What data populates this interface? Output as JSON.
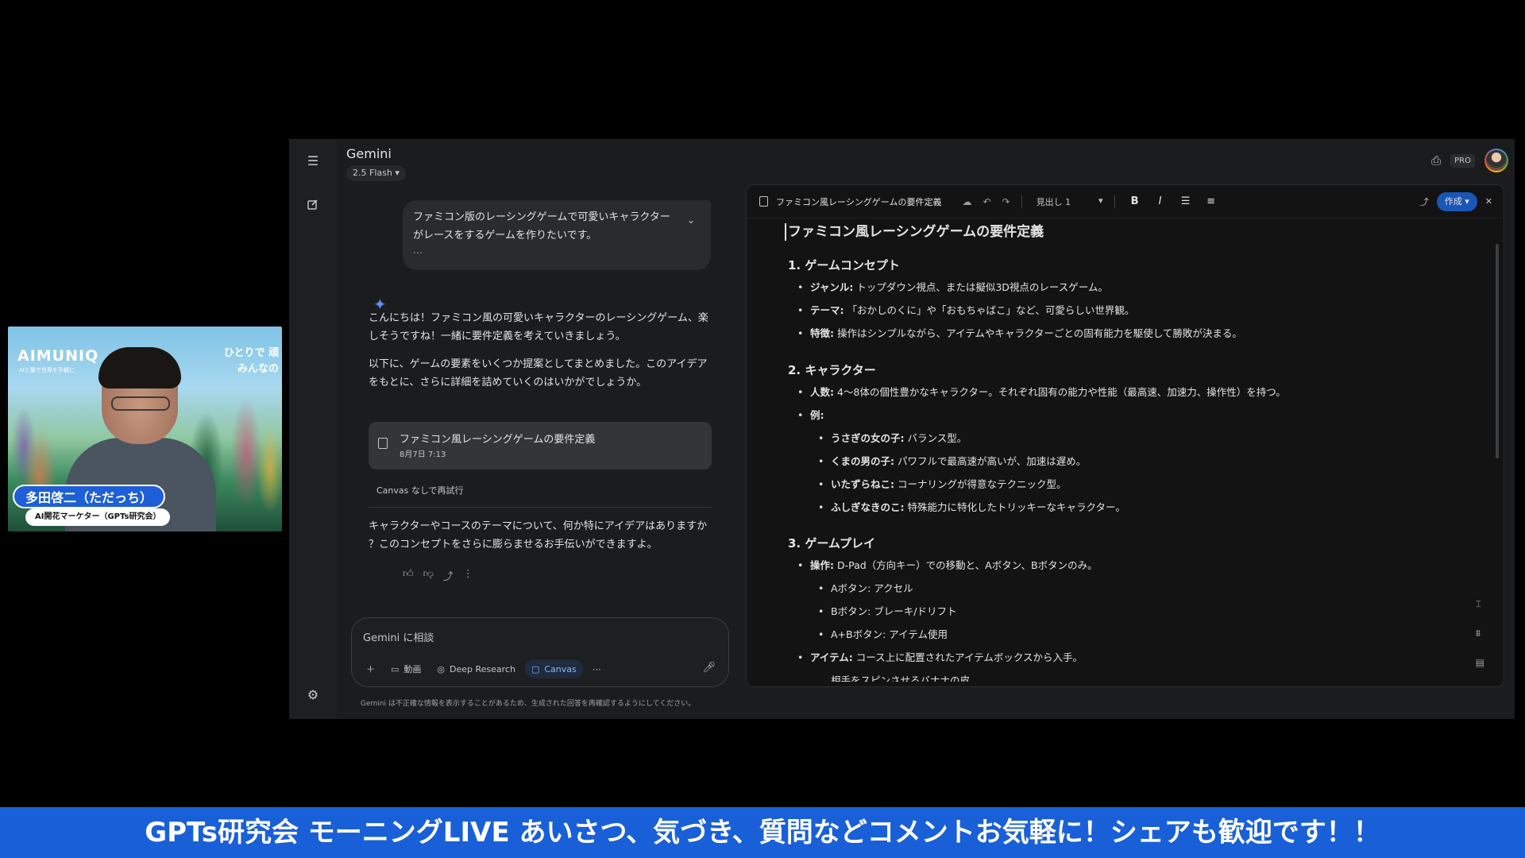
{
  "webcam": {
    "logo": "AIMUNIQ",
    "logo_sub": "AIと繋で世界を手軽に",
    "copy_line1": "ひとりで 頑",
    "copy_line2": "みんなの",
    "name": "多田啓二（ただっち）",
    "role": "AI開花マーケター（GPTs研究会）"
  },
  "app": {
    "title": "Gemini",
    "model": "2.5 Flash",
    "pro_badge": "PRO"
  },
  "chat": {
    "user_message_line1": "ファミコン版のレーシングゲームで可愛いキャラクター",
    "user_message_line2": "がレースをするゲームを作りたいです。",
    "user_message_more": "…",
    "response_p1_line1": "こんにちは！ファミコン風の可愛いキャラクターのレーシングゲーム、楽",
    "response_p1_line2": "しそうですね！一緒に要件定義を考えていきましょう。",
    "response_p2_line1": "以下に、ゲームの要素をいくつか提案としてまとめました。このアイデア",
    "response_p2_line2": "をもとに、さらに詳細を詰めていくのはいかがでしょうか。",
    "doc_card_title": "ファミコン風レーシングゲームの要件定義",
    "doc_card_date": "8月7日 7:13",
    "retry_label": "Canvas なしで再試行",
    "response_p3_line1": "キャラクターやコースのテーマについて、何か特にアイデアはありますか",
    "response_p3_line2": "？このコンセプトをさらに膨らませるお手伝いができますよ。"
  },
  "composer": {
    "placeholder": "Gemini に相談",
    "tool_video": "動画",
    "tool_research": "Deep Research",
    "tool_canvas": "Canvas",
    "tool_more": "⋯",
    "disclaimer": "Gemini は不正確な情報を表示することがあるため、生成された回答を再確認するようにしてください。"
  },
  "canvas": {
    "doc_title": "ファミコン風レーシングゲームの要件定義",
    "heading_select": "見出し 1",
    "create_button": "作成",
    "h1": "ファミコン風レーシングゲームの要件定義",
    "s1": "1. ゲームコンセプト",
    "s1_genre_label": "ジャンル:",
    "s1_genre": " トップダウン視点、または擬似3D視点のレースゲーム。",
    "s1_theme_label": "テーマ:",
    "s1_theme": " 「おかしのくに」や「おもちゃばこ」など、可愛らしい世界観。",
    "s1_feature_label": "特徴:",
    "s1_feature": " 操作はシンプルながら、アイテムやキャラクターごとの固有能力を駆使して勝敗が決まる。",
    "s2": "2. キャラクター",
    "s2_count_label": "人数:",
    "s2_count": " 4〜8体の個性豊かなキャラクター。それぞれ固有の能力や性能（最高速、加速力、操作性）を持つ。",
    "s2_example_label": "例:",
    "s2_c1_label": "うさぎの女の子:",
    "s2_c1": " バランス型。",
    "s2_c2_label": "くまの男の子:",
    "s2_c2": " パワフルで最高速が高いが、加速は遅め。",
    "s2_c3_label": "いたずらねこ:",
    "s2_c3": " コーナリングが得意なテクニック型。",
    "s2_c4_label": "ふしぎなきのこ:",
    "s2_c4": " 特殊能力に特化したトリッキーなキャラクター。",
    "s3": "3. ゲームプレイ",
    "s3_control_label": "操作:",
    "s3_control": " D-Pad（方向キー）での移動と、Aボタン、Bボタンのみ。",
    "s3_a": "Aボタン: アクセル",
    "s3_b": "Bボタン: ブレーキ/ドリフト",
    "s3_ab": "A+Bボタン: アイテム使用",
    "s3_item_label": "アイテム:",
    "s3_item": " コース上に配置されたアイテムボックスから入手。",
    "s3_item_cut": "相手をスピンさせるバナナの皮"
  },
  "banner": {
    "text": "GPTs研究会 モーニングLIVE あいさつ、気づき、質問などコメントお気軽に！シェアも歓迎です！！"
  },
  "colors": {
    "banner": "#1960d8",
    "accent_blue": "#8ab4f8",
    "surface": "#1b1c1d",
    "canvas_bg": "#131314"
  }
}
